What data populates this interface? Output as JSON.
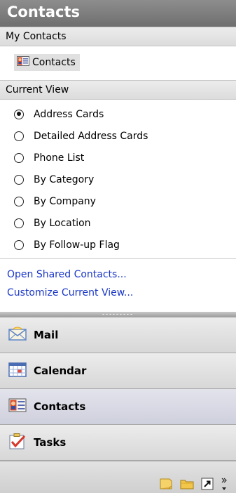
{
  "pane": {
    "title": "Contacts"
  },
  "my_contacts": {
    "header": "My Contacts",
    "folders": [
      {
        "label": "Contacts",
        "icon": "contacts-card-icon"
      }
    ]
  },
  "current_view": {
    "header": "Current View",
    "options": [
      {
        "label": "Address Cards",
        "selected": true
      },
      {
        "label": "Detailed Address Cards",
        "selected": false
      },
      {
        "label": "Phone List",
        "selected": false
      },
      {
        "label": "By Category",
        "selected": false
      },
      {
        "label": "By Company",
        "selected": false
      },
      {
        "label": "By Location",
        "selected": false
      },
      {
        "label": "By Follow-up Flag",
        "selected": false
      }
    ]
  },
  "links": {
    "open_shared": "Open Shared Contacts...",
    "customize": "Customize Current View..."
  },
  "nav_buttons": [
    {
      "label": "Mail",
      "icon": "mail-icon",
      "selected": false
    },
    {
      "label": "Calendar",
      "icon": "calendar-icon",
      "selected": false
    },
    {
      "label": "Contacts",
      "icon": "contacts-icon",
      "selected": true
    },
    {
      "label": "Tasks",
      "icon": "tasks-icon",
      "selected": false
    }
  ],
  "bottom_icons": [
    "notes-icon",
    "folder-list-icon",
    "shortcuts-icon",
    "configure-buttons-icon"
  ],
  "colors": {
    "link": "#1a37c8",
    "title_bar": "#7a7a7a"
  }
}
